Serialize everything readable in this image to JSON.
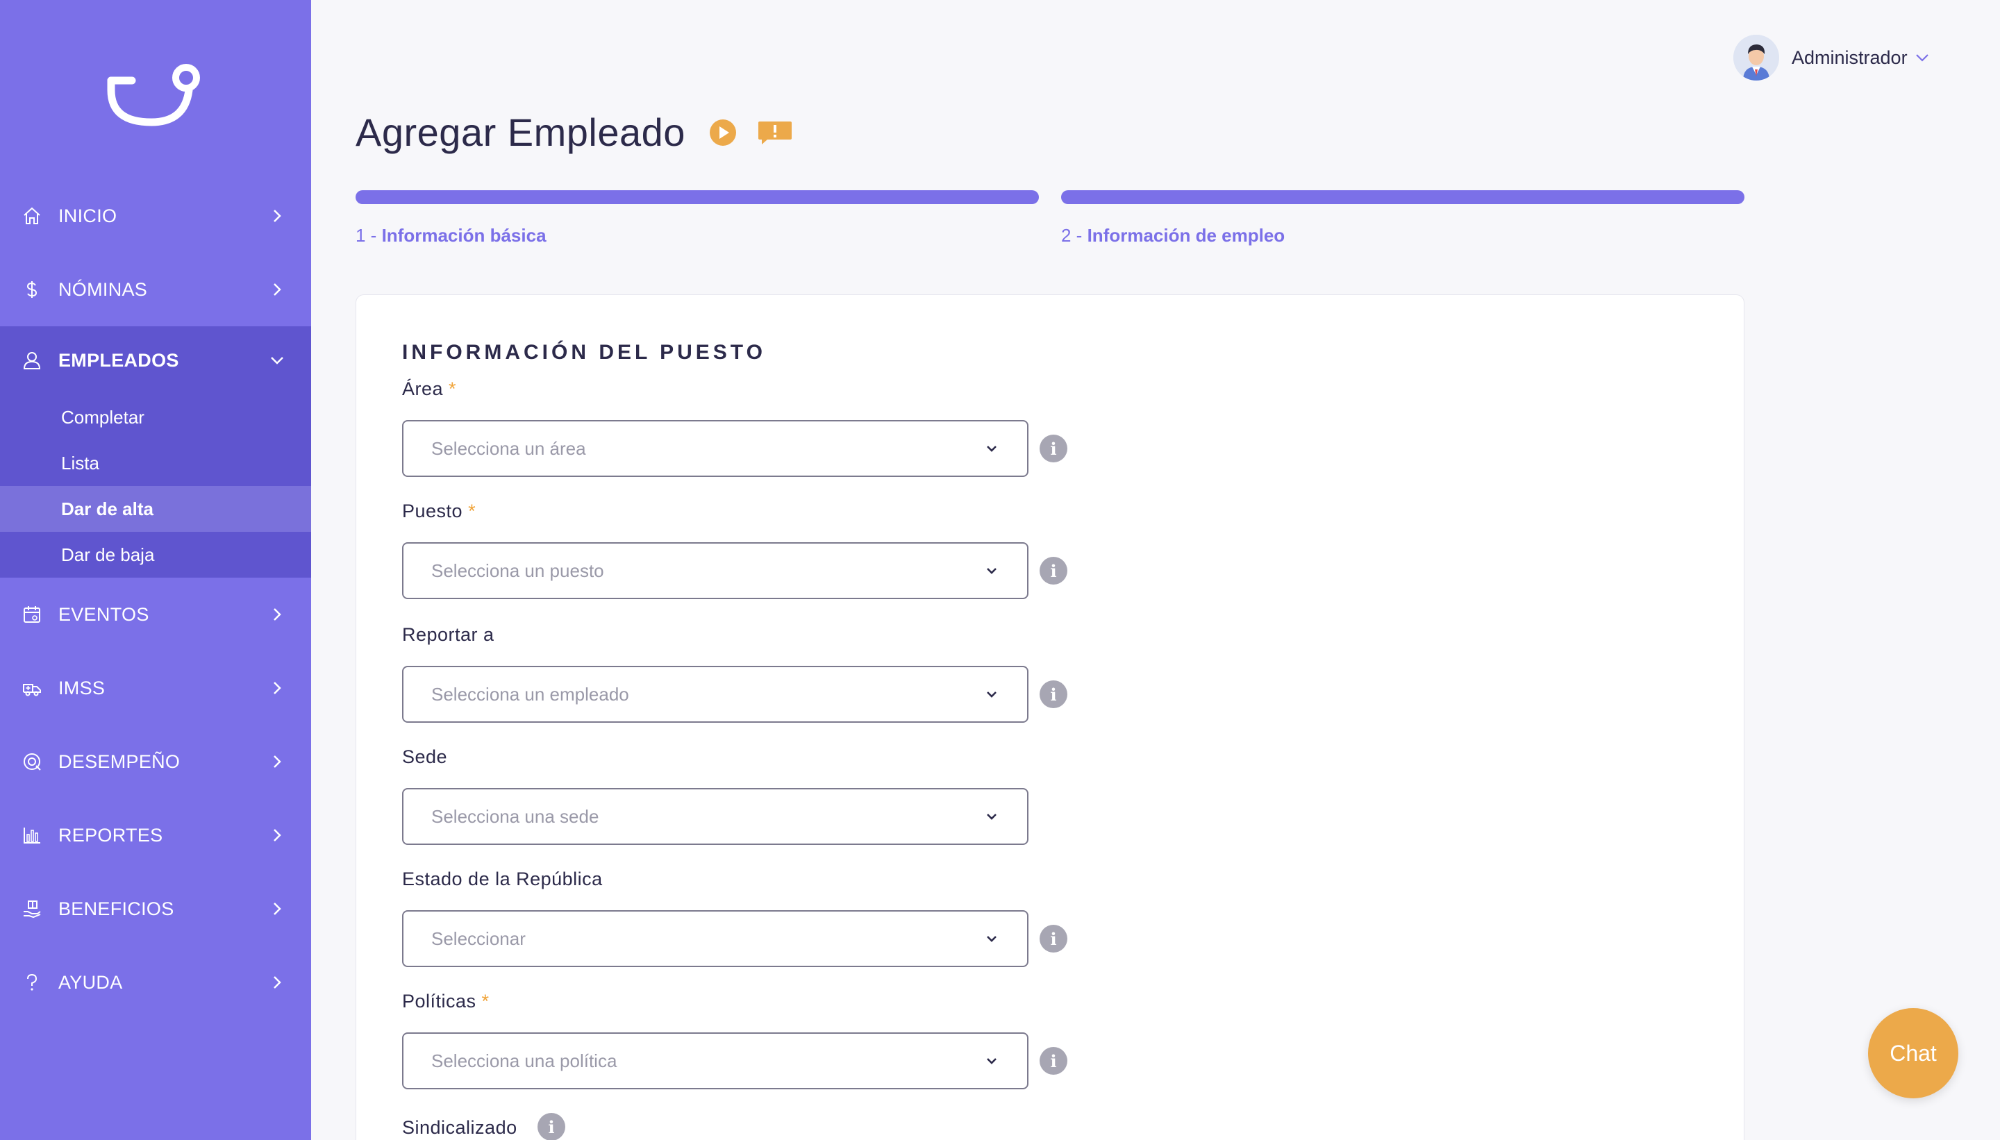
{
  "sidebar": {
    "items": [
      {
        "label": "INICIO",
        "icon": "home-icon"
      },
      {
        "label": "NÓMINAS",
        "icon": "dollar-icon"
      },
      {
        "label": "EMPLEADOS",
        "icon": "user-icon"
      },
      {
        "label": "EVENTOS",
        "icon": "calendar-icon"
      },
      {
        "label": "IMSS",
        "icon": "ambulance-icon"
      },
      {
        "label": "DESEMPEÑO",
        "icon": "target-icon"
      },
      {
        "label": "REPORTES",
        "icon": "bar-chart-icon"
      },
      {
        "label": "BENEFICIOS",
        "icon": "gift-hand-icon"
      },
      {
        "label": "AYUDA",
        "icon": "question-icon"
      }
    ],
    "sub_items": [
      {
        "label": "Completar"
      },
      {
        "label": "Lista"
      },
      {
        "label": "Dar de alta"
      },
      {
        "label": "Dar de baja"
      }
    ]
  },
  "header": {
    "user_name": "Administrador"
  },
  "page": {
    "title": "Agregar Empleado"
  },
  "steps": [
    {
      "num": "1 - ",
      "label": "Información básica"
    },
    {
      "num": "2 - ",
      "label": "Información de empleo"
    }
  ],
  "form": {
    "section_title": "INFORMACIÓN DEL PUESTO",
    "required_mark": "*",
    "fields": [
      {
        "label": "Área",
        "placeholder": "Selecciona un área"
      },
      {
        "label": "Puesto",
        "placeholder": "Selecciona un puesto"
      },
      {
        "label": "Reportar a",
        "placeholder": "Selecciona un empleado"
      },
      {
        "label": "Sede",
        "placeholder": "Selecciona una sede"
      },
      {
        "label": "Estado de la República",
        "placeholder": "Seleccionar"
      },
      {
        "label": "Políticas",
        "placeholder": "Selecciona una política"
      },
      {
        "label": "Sindicalizado"
      }
    ],
    "info_glyph": "i"
  },
  "chat": {
    "label": "Chat"
  },
  "colors": {
    "sidebar": "#7b70e8",
    "sidebar_active": "#5f55cf",
    "accent": "#7b70e8",
    "required": "#f0a43a",
    "chat": "#eca94a"
  }
}
